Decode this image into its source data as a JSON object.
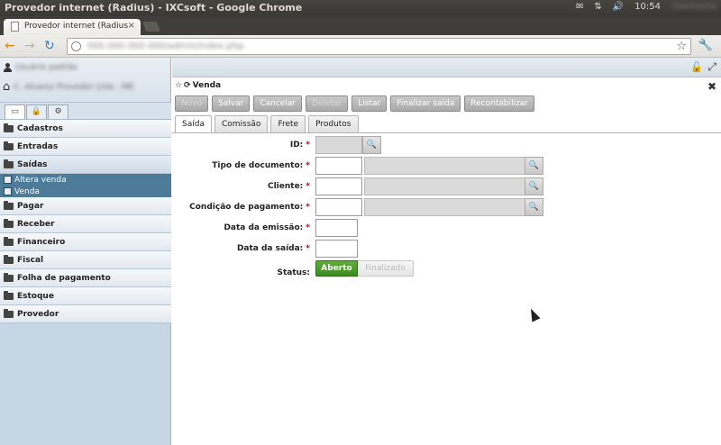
{
  "os": {
    "window_title": "Provedor internet (Radius) - IXCsoft - Google Chrome",
    "clock": "10:54",
    "user": "Username"
  },
  "browser": {
    "tab_title": "Provedor internet (Radius",
    "tab_close": "×",
    "url": "000.000.000.000/admin/index.php",
    "back": "←",
    "forward": "→",
    "reload": "↻",
    "star": "☆",
    "wrench": "🔧"
  },
  "sidebar": {
    "user_name": "Usuário padrão",
    "company": "C. Alvarez Provedor Ltda - ME",
    "tabs": [
      "▭",
      "🔒",
      "⚙"
    ],
    "menu": [
      {
        "label": "Cadastros"
      },
      {
        "label": "Entradas"
      },
      {
        "label": "Saídas",
        "open": true,
        "children": [
          "Altera venda",
          "Venda"
        ]
      },
      {
        "label": "Pagar"
      },
      {
        "label": "Receber"
      },
      {
        "label": "Financeiro"
      },
      {
        "label": "Fiscal"
      },
      {
        "label": "Folha de pagamento"
      },
      {
        "label": "Estoque"
      },
      {
        "label": "Provedor"
      }
    ]
  },
  "window": {
    "title": "Venda",
    "close": "✖",
    "lock": "🔓",
    "maximize": "⤢"
  },
  "toolbar": {
    "novo": "Novo",
    "salvar": "Salvar",
    "cancelar": "Cancelar",
    "deletar": "Deletar",
    "listar": "Listar",
    "finalizar": "Finalizar saída",
    "recontabilizar": "Recontabilizar"
  },
  "tabs": [
    "Saída",
    "Comissão",
    "Frete",
    "Produtos"
  ],
  "form": {
    "id_label": "ID:",
    "tipo_label": "Tipo de documento:",
    "cliente_label": "Cliente:",
    "condicao_label": "Condição de pagamento:",
    "emissao_label": "Data da emissão:",
    "saida_label": "Data da saída:",
    "status_label": "Status:",
    "required_mark": "*",
    "search_glyph": "🔍",
    "status_on": "Aberto",
    "status_off": "Finalizado"
  }
}
